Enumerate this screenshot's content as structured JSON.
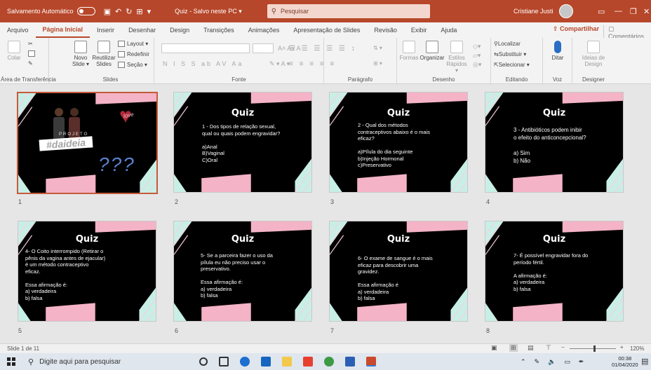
{
  "titlebar": {
    "autosave": "Salvamento Automático",
    "doc_title": "Quiz - Salvo neste PC ▾",
    "search": "Pesquisar",
    "user": "Cristiane Justi"
  },
  "tabs": [
    "Arquivo",
    "Página Inicial",
    "Inserir",
    "Desenhar",
    "Design",
    "Transições",
    "Animações",
    "Apresentação de Slides",
    "Revisão",
    "Exibir",
    "Ajuda"
  ],
  "share_label": "Compartilhar",
  "comments_label": "Comentários",
  "ribbon": {
    "clipboard": {
      "label": "Área de Transferência",
      "paste": "Colar"
    },
    "slides": {
      "label": "Slides",
      "new_slide": "Novo Slide ▾",
      "reuse": "Reutilizar Slides",
      "layout": "Layout ▾",
      "reset": "Redefinir",
      "section": "Seção ▾"
    },
    "font": {
      "label": "Fonte"
    },
    "paragraph": {
      "label": "Parágrafo"
    },
    "drawing": {
      "label": "Desenho",
      "shapes": "Formas",
      "arrange": "Organizar",
      "styles": "Estilos Rápidos ▾"
    },
    "editing": {
      "label": "Editando",
      "find": "Localizar",
      "replace": "Substituir ▾",
      "select": "Selecionar ▾"
    },
    "voice": {
      "label": "Voz",
      "dictate": "Ditar"
    },
    "designer": {
      "label": "Designer",
      "ideas": "Ideias de Design"
    }
  },
  "slides": [
    {
      "num": "1",
      "cover": true,
      "label": "PROJETO",
      "hashtag": "#daideia",
      "love": "love",
      "marks": "???"
    },
    {
      "num": "2",
      "title": "Quiz",
      "text": "1 - Dos tipos de relação sexual,\nqual ou quais podem engravidar?\n\na)Anal\nB)Vaginal\nC)Oral"
    },
    {
      "num": "3",
      "title": "Quiz",
      "text": "2 - Qual dos métodos\ncontraceptivos abaixo é o mais\neficaz?\n\na)Pílula do dia seguinte\nb)Injeção Hormonal\nc)Preservativo"
    },
    {
      "num": "4",
      "title": "Quiz",
      "text": "3 - Antibióticos podem inibir\no efeito do anticoncepcional?\n\na) Sim\nb) Não"
    },
    {
      "num": "5",
      "title": "Quiz",
      "text": "4- O Coito interrompido (Retirar o\npênis da vagina antes de ejacular)\né um método contraceptivo\neficaz.\n\nEssa afirmação é:\na) verdadeira\nb) falsa"
    },
    {
      "num": "6",
      "title": "Quiz",
      "text": "5- Se a parceira fazer o  uso da\npílula eu não preciso usar o\npreservativo.\n\nEssa afirmação é:\na) verdadeira\nb) falsa"
    },
    {
      "num": "7",
      "title": "Quiz",
      "text": "6- O exame de sangue é o mais\neficaz para descobrir uma\ngravidez.\n\nEssa afirmação é\na)  verdadeira\nb) falsa"
    },
    {
      "num": "8",
      "title": "Quiz",
      "text": "7- É possível engravidar fora do\nperíodo fértil.\n\nA afirmação é:\na) verdadeira\nb) falsa"
    }
  ],
  "statusbar": {
    "slide_info": "Slide 1 de 11",
    "zoom": "120%"
  },
  "taskbar": {
    "search_placeholder": "Digite aqui para pesquisar",
    "time": "00:38",
    "date": "01/04/2020"
  },
  "colors": {
    "accent": "#b7472a",
    "pink": "#f4b3c6",
    "mint": "#c8efe6",
    "stripe": "#f7cfe0"
  }
}
